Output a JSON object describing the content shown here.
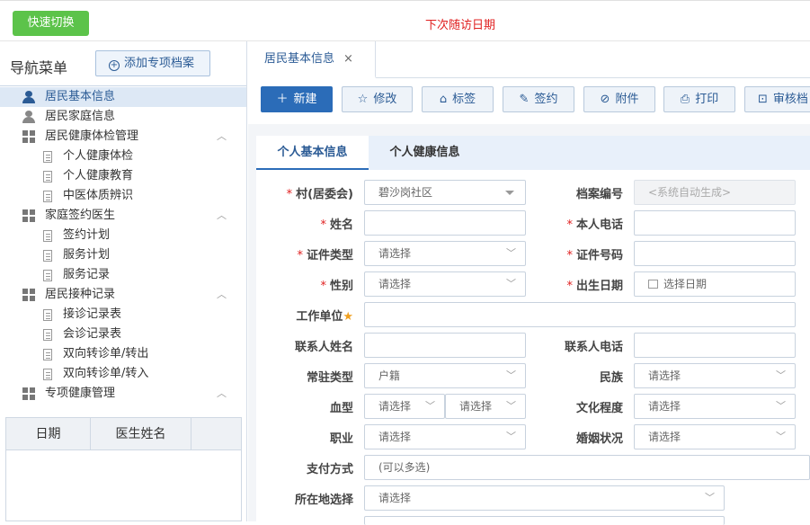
{
  "header": {
    "quick_switch_label": "快速切换",
    "next_visit_label": "下次随访日期"
  },
  "sidebar": {
    "title": "导航菜单",
    "add_button_label": "添加专项档案",
    "items": [
      {
        "label": "居民基本信息",
        "icon": "person-icon",
        "level": 1,
        "selected": true
      },
      {
        "label": "居民家庭信息",
        "icon": "person-icon",
        "level": 1
      },
      {
        "label": "居民健康体检管理",
        "icon": "grid-icon",
        "level": 1,
        "expanded": true
      },
      {
        "label": "个人健康体检",
        "icon": "document-icon",
        "level": 2
      },
      {
        "label": "个人健康教育",
        "icon": "document-icon",
        "level": 2
      },
      {
        "label": "中医体质辨识",
        "icon": "document-icon",
        "level": 2
      },
      {
        "label": "家庭签约医生",
        "icon": "grid-icon",
        "level": 1,
        "expanded": true
      },
      {
        "label": "签约计划",
        "icon": "document-icon",
        "level": 2
      },
      {
        "label": "服务计划",
        "icon": "document-icon",
        "level": 2
      },
      {
        "label": "服务记录",
        "icon": "document-icon",
        "level": 2
      },
      {
        "label": "居民接种记录",
        "icon": "grid-icon",
        "level": 1,
        "expanded": true
      },
      {
        "label": "接诊记录表",
        "icon": "document-icon",
        "level": 2
      },
      {
        "label": "会诊记录表",
        "icon": "document-icon",
        "level": 2
      },
      {
        "label": "双向转诊单/转出",
        "icon": "document-icon",
        "level": 2
      },
      {
        "label": "双向转诊单/转入",
        "icon": "document-icon",
        "level": 2
      },
      {
        "label": "专项健康管理",
        "icon": "grid-icon",
        "level": 1,
        "expanded": true
      }
    ],
    "table_headers": [
      "日期",
      "医生姓名"
    ]
  },
  "tabs": [
    {
      "label": "居民基本信息",
      "close": "×"
    }
  ],
  "toolbar": {
    "new_label": "新建",
    "edit_label": "修改",
    "tag_label": "标签",
    "sign_label": "签约",
    "attach_label": "附件",
    "print_label": "打印",
    "audit_label": "审核档"
  },
  "form_tabs": [
    "个人基本信息",
    "个人健康信息"
  ],
  "form": {
    "village_label": "村(居委会)",
    "village_value": "碧沙岗社区",
    "archive_no_label": "档案编号",
    "archive_no_placeholder": "<系统自动生成>",
    "name_label": "姓名",
    "phone_label": "本人电话",
    "id_type_label": "证件类型",
    "id_type_value": "请选择",
    "id_no_label": "证件号码",
    "gender_label": "性别",
    "gender_value": "请选择",
    "birth_label": "出生日期",
    "birth_value": "选择日期",
    "work_label": "工作单位",
    "contact_name_label": "联系人姓名",
    "contact_phone_label": "联系人电话",
    "residence_label": "常驻类型",
    "residence_value": "户籍",
    "ethnic_label": "民族",
    "ethnic_value": "请选择",
    "blood_label": "血型",
    "blood_value1": "请选择",
    "blood_value2": "请选择",
    "education_label": "文化程度",
    "education_value": "请选择",
    "job_label": "职业",
    "job_value": "请选择",
    "marital_label": "婚姻状况",
    "marital_value": "请选择",
    "payment_label": "支付方式",
    "payment_value": "(可以多选)",
    "location_label": "所在地选择",
    "location_value": "请选择"
  },
  "colors": {
    "primary": "#2b6cb8",
    "quick_switch": "#5cc34a",
    "required": "#e02020"
  }
}
